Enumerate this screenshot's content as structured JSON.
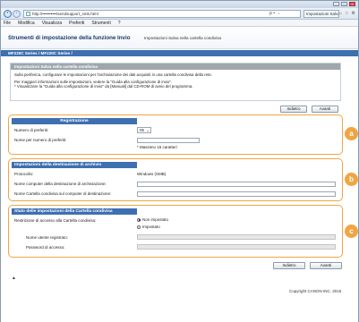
{
  "browser": {
    "url": "http://••••••••••/sendsupport_smb.html",
    "url_tools": "ρ • →",
    "tab_title": "Impostazioni Salva ne...",
    "menu": [
      "File",
      "Modifica",
      "Visualizza",
      "Preferiti",
      "Strumenti",
      "?"
    ]
  },
  "page": {
    "title": "Strumenti di impostazione della funzione Invio",
    "subtitle": "Impostazioni Salva nella cartella condivisa",
    "model_bar": "MF220C Series / MF220C Series /"
  },
  "intro": {
    "heading": "Impostazioni Salva nella cartella condivisa",
    "line1": "Sulla periferica, configurare le impostazioni per l'archiviazione dei dati acquisiti in una cartella condivisa della rete.",
    "line2": "Per maggiori informazioni sulle impostazioni, vedere la \"Guida alla configurazione di invio\".",
    "line3": "* Visualizzare la \"Guida alla configurazione di invio\" da [Manuali] dal CD-ROM di avvio del programma."
  },
  "buttons": {
    "back": "Indietro",
    "next": "Avanti"
  },
  "registration": {
    "heading": "Registrazione",
    "num_prefs_label": "Numero di preferiti:",
    "num_prefs_value": "05",
    "name_label": "Nome per numero di preferiti:",
    "name_value": "",
    "name_hint": "* Massimo 16 caratteri"
  },
  "destination": {
    "heading": "Impostazioni della destinazione di archivio",
    "protocol_label": "Protocollo:",
    "protocol_value": "Windows (SMB)",
    "host_label": "Nome computer della destinazione di archiviazione:",
    "host_value": "",
    "folder_label": "Nome Cartella condivisa sul computer di destinazione:",
    "folder_value": ""
  },
  "status": {
    "heading": "Stato delle impostazioni della Cartella condivisa",
    "restriction_label": "Restrizione di accesso alla Cartella condivisa:",
    "option_off": "Non impostato",
    "option_on": "Impostato",
    "selected": "Non impostato",
    "user_label": "Nome utente registrato:",
    "password_label": "Password di accesso:"
  },
  "badges": [
    "a",
    "b",
    "c"
  ],
  "footer": {
    "top_link": "▲",
    "copyright": "Copyright CANON INC. 2015"
  },
  "colors": {
    "accent_blue": "#3e6fb0",
    "highlight_orange": "#f0a544",
    "intro_head_gray": "#9fa6ae"
  }
}
